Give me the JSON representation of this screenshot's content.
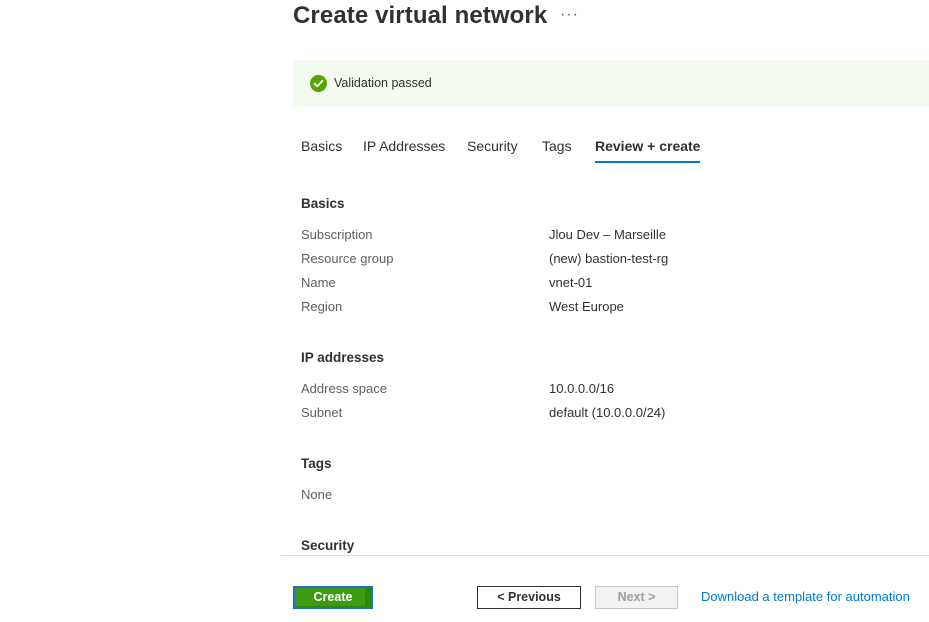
{
  "header": {
    "title": "Create virtual network",
    "more_label": "···"
  },
  "banner": {
    "icon": "check-circle-icon",
    "message": "Validation passed",
    "color": "#57a300"
  },
  "tabs": [
    {
      "label": "Basics"
    },
    {
      "label": "IP Addresses"
    },
    {
      "label": "Security"
    },
    {
      "label": "Tags"
    },
    {
      "label": "Review + create",
      "active": true
    }
  ],
  "review": {
    "basics": {
      "title": "Basics",
      "rows": [
        {
          "label": "Subscription",
          "value": "Jlou Dev – Marseille"
        },
        {
          "label": "Resource group",
          "value": "(new) bastion-test-rg"
        },
        {
          "label": "Name",
          "value": "vnet-01"
        },
        {
          "label": "Region",
          "value": "West Europe"
        }
      ]
    },
    "ip": {
      "title": "IP addresses",
      "rows": [
        {
          "label": "Address space",
          "value": "10.0.0.0/16"
        },
        {
          "label": "Subnet",
          "value": "default (10.0.0.0/24)"
        }
      ]
    },
    "tags": {
      "title": "Tags",
      "value": "None"
    },
    "security": {
      "title": "Security"
    }
  },
  "footer": {
    "create_label": "Create",
    "previous_label": "< Previous",
    "next_label": "Next >",
    "template_link": "Download a template for automation"
  }
}
